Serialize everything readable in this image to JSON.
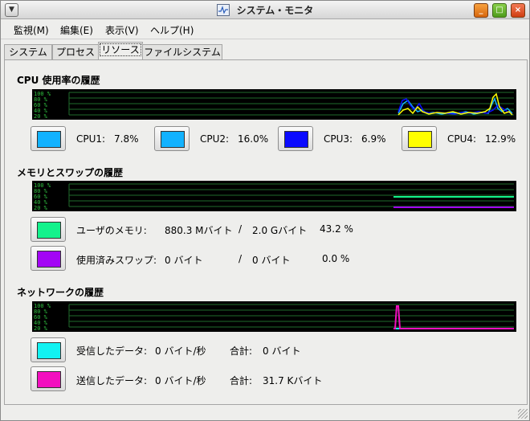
{
  "window": {
    "title": "システム・モニタ"
  },
  "menu": [
    "監視(M)",
    "編集(E)",
    "表示(V)",
    "ヘルプ(H)"
  ],
  "tabs": [
    "システム",
    "プロセス",
    "リソース",
    "ファイルシステム"
  ],
  "active_tab": "リソース",
  "cpu": {
    "title": "CPU 使用率の履歴",
    "graph_ticks": [
      "100 %",
      "80 %",
      "60 %",
      "40 %",
      "20 %"
    ],
    "items": [
      {
        "label": "CPU1:",
        "value": "7.8%",
        "color": "#12b2ff"
      },
      {
        "label": "CPU2:",
        "value": "16.0%",
        "color": "#12b2ff"
      },
      {
        "label": "CPU3:",
        "value": "6.9%",
        "color": "#0a0aff"
      },
      {
        "label": "CPU4:",
        "value": "12.9%",
        "color": "#ffff00"
      }
    ]
  },
  "memory": {
    "title": "メモリとスワップの履歴",
    "graph_ticks": [
      "100 %",
      "80 %",
      "60 %",
      "40 %",
      "20 %"
    ],
    "user": {
      "label": "ユーザのメモリ:",
      "used": "880.3 Mバイト",
      "sep": "/",
      "total": "2.0 Gバイト",
      "percent": "43.2 %",
      "color": "#13f28c"
    },
    "swap": {
      "label": "使用済みスワップ:",
      "used": "0 バイト",
      "sep": "/",
      "total": "0 バイト",
      "percent": "0.0 %",
      "color": "#a305f5"
    }
  },
  "network": {
    "title": "ネットワークの履歴",
    "graph_ticks": [
      "100 %",
      "80 %",
      "60 %",
      "40 %",
      "20 %"
    ],
    "received": {
      "label": "受信したデータ:",
      "rate": "0 バイト/秒",
      "total_label": "合計:",
      "total": "0 バイト",
      "color": "#12f2f2"
    },
    "sent": {
      "label": "送信したデータ:",
      "rate": "0 バイト/秒",
      "total_label": "合計:",
      "total": "31.7 Kバイト",
      "color": "#f20fbf"
    }
  }
}
